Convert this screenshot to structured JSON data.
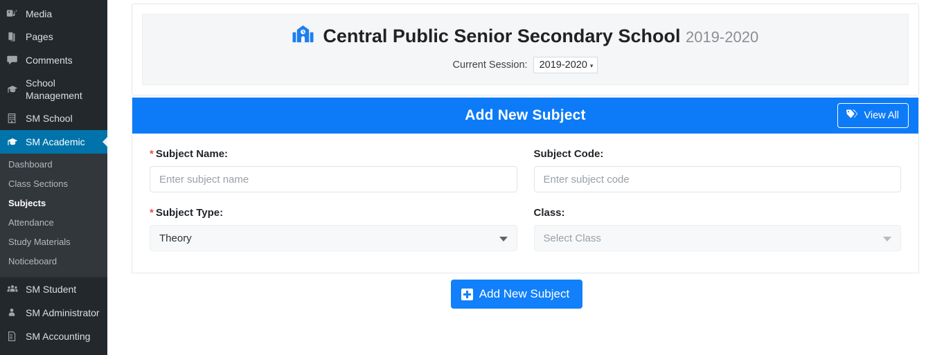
{
  "sidebar": {
    "items": [
      {
        "label": "Media",
        "icon": "media-icon",
        "active": false
      },
      {
        "label": "Pages",
        "icon": "pages-icon",
        "active": false
      },
      {
        "label": "Comments",
        "icon": "comments-icon",
        "active": false
      },
      {
        "label": "School Management",
        "icon": "graduation-cap-icon",
        "active": false
      },
      {
        "label": "SM School",
        "icon": "building-icon",
        "active": false
      },
      {
        "label": "SM Academic",
        "icon": "graduation-cap-icon",
        "active": true
      }
    ],
    "submenu": [
      {
        "label": "Dashboard",
        "current": false
      },
      {
        "label": "Class Sections",
        "current": false
      },
      {
        "label": "Subjects",
        "current": true
      },
      {
        "label": "Attendance",
        "current": false
      },
      {
        "label": "Study Materials",
        "current": false
      },
      {
        "label": "Noticeboard",
        "current": false
      }
    ],
    "items_after": [
      {
        "label": "SM Student",
        "icon": "users-icon"
      },
      {
        "label": "SM Administrator",
        "icon": "user-icon"
      },
      {
        "label": "SM Accounting",
        "icon": "document-icon"
      }
    ]
  },
  "banner": {
    "icon": "school-building-clock-icon",
    "school_name": "Central Public Senior Secondary School",
    "session_year": "2019-2020",
    "session_label": "Current Session:",
    "session_value": "2019-2020",
    "session_caret": "▾"
  },
  "panel": {
    "title": "Add New Subject",
    "view_all_label": "View All",
    "view_all_icon": "tags-icon"
  },
  "form": {
    "subject_name": {
      "label": "Subject Name:",
      "required_marker": "*",
      "placeholder": "Enter subject name",
      "value": ""
    },
    "subject_code": {
      "label": "Subject Code:",
      "placeholder": "Enter subject code",
      "value": ""
    },
    "subject_type": {
      "label": "Subject Type:",
      "required_marker": "*",
      "selected": "Theory"
    },
    "class": {
      "label": "Class:",
      "selected": "Select Class"
    }
  },
  "submit": {
    "label": "Add New Subject",
    "icon": "plus-square-icon"
  },
  "colors": {
    "sidebar_bg": "#23282d",
    "sidebar_submenu_bg": "#32373c",
    "sidebar_active": "#0073aa",
    "panel_header_blue": "#0d7bf7",
    "button_blue": "#1180fa",
    "required_red": "#e8513c"
  }
}
